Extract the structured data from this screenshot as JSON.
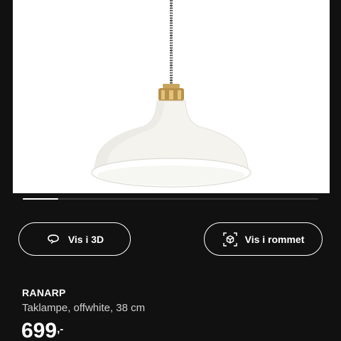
{
  "product_image": {
    "subject": "pendant-lamp",
    "colors": {
      "background": "#ffffff",
      "shade": "#f4f3ee",
      "shade_shadow": "#dcdbd4",
      "brass": "#c9a45a",
      "cord": "#6b6b6b"
    }
  },
  "carousel": {
    "progress": 0.12
  },
  "actions": {
    "view_3d": {
      "label": "Vis i 3D",
      "icon": "rotate-3d-icon"
    },
    "view_in_room": {
      "label": "Vis i rommet",
      "icon": "ar-cube-icon"
    }
  },
  "product": {
    "name": "RANARP",
    "description": "Taklampe, offwhite, 38 cm",
    "price": "699",
    "price_suffix": ",-"
  },
  "theme": {
    "page_background": "#111111",
    "text": "#ffffff",
    "secondary_text": "#cfcfcf"
  }
}
